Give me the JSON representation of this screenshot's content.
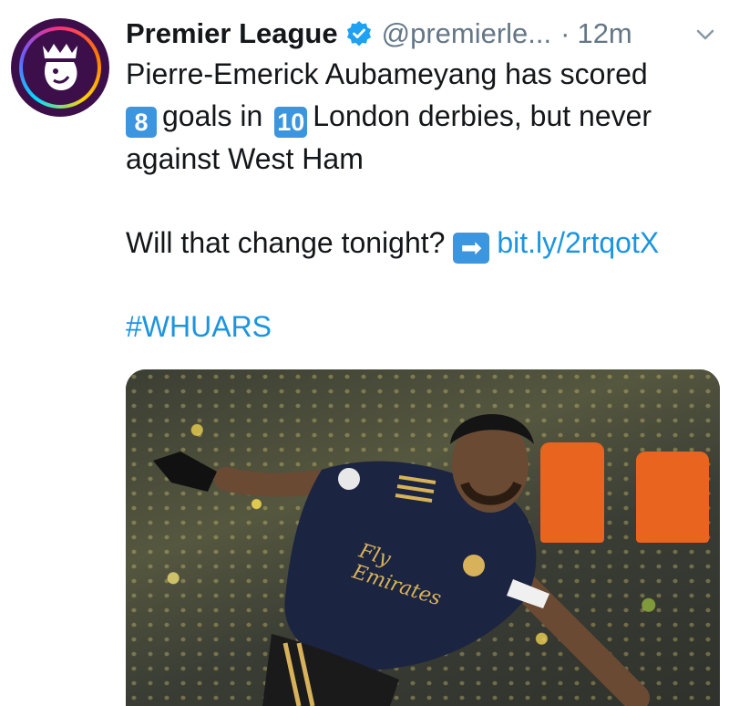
{
  "account": {
    "name": "Premier League",
    "handle": "@premierle...",
    "separator": "·",
    "time": "12m",
    "verified": true,
    "avatar_icon": "premier-league-lion-icon"
  },
  "tweet": {
    "line1": "Pierre-Emerick Aubameyang has scored",
    "goals_keycap": "8",
    "line2_mid": "goals in",
    "derbies_keycap": "10",
    "line2_end": "London derbies, but never",
    "line3": "against West Ham",
    "line4_text": "Will that change tonight?",
    "arrow_glyph": "➡",
    "link": "bit.ly/2rtqotX",
    "hashtag": "#WHUARS"
  },
  "media": {
    "sponsor_text": "Fly Emirates"
  },
  "colors": {
    "link": "#1b95e0",
    "verified": "#1da1f2",
    "keycap": "#3b95df",
    "muted": "#657786"
  }
}
